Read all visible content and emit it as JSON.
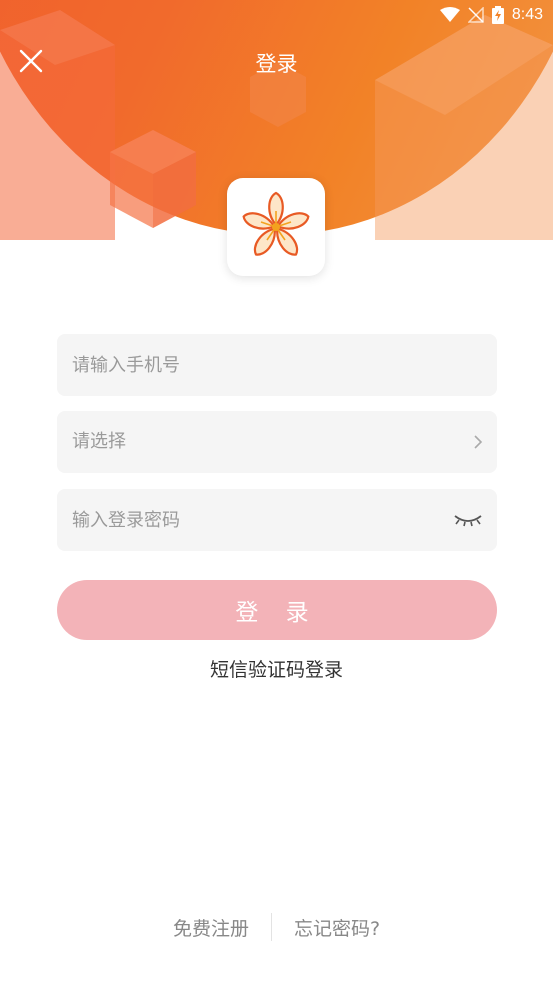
{
  "status_bar": {
    "time": "8:43"
  },
  "header": {
    "title": "登录"
  },
  "form": {
    "phone_placeholder": "请输入手机号",
    "select_placeholder": "请选择",
    "password_placeholder": "输入登录密码"
  },
  "actions": {
    "login_label": "登 录",
    "sms_login_label": "短信验证码登录"
  },
  "footer": {
    "register_label": "免费注册",
    "forgot_label": "忘记密码?"
  },
  "colors": {
    "header_gradient_start": "#f0582e",
    "header_gradient_end": "#f39848",
    "login_button": "#f3b3b8",
    "field_background": "#f5f5f5"
  }
}
